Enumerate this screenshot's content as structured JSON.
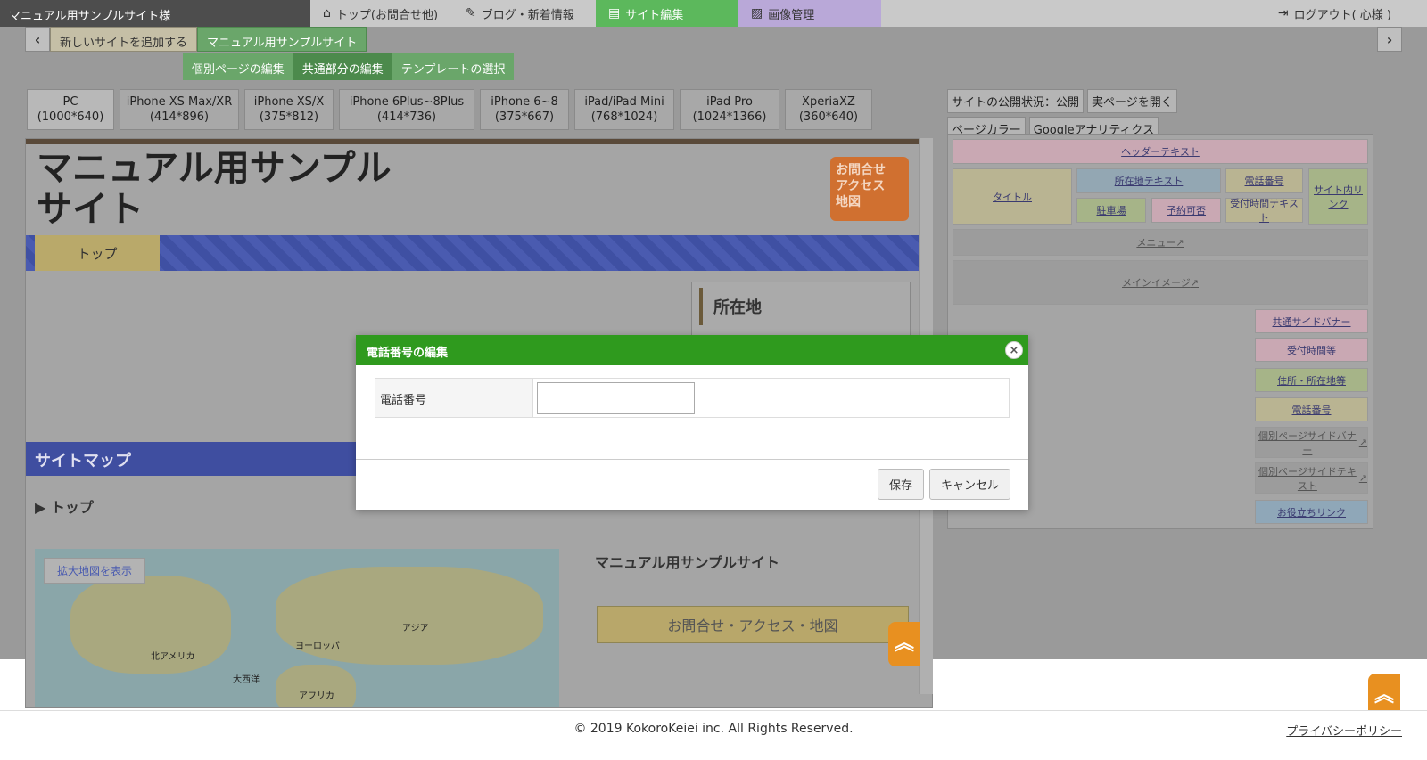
{
  "topnav": {
    "site_name": "マニュアル用サンプルサイト様",
    "tabs": [
      {
        "label": "トップ(お問合せ他)",
        "icon": "home-icon"
      },
      {
        "label": "ブログ・新着情報",
        "icon": "pen-icon"
      },
      {
        "label": "サイト編集",
        "icon": "document-icon"
      },
      {
        "label": "画像管理",
        "icon": "image-icon"
      }
    ],
    "logout": "ログアウト( 心様 )"
  },
  "breadcrumb": {
    "items": [
      "新しいサイトを追加する",
      "マニュアル用サンプルサイト"
    ]
  },
  "subtabs": [
    "個別ページの編集",
    "共通部分の編集",
    "テンプレートの選択"
  ],
  "devices": [
    {
      "name": "PC",
      "size": "(1000*640)"
    },
    {
      "name": "iPhone XS Max/XR",
      "size": "(414*896)"
    },
    {
      "name": "iPhone XS/X",
      "size": "(375*812)"
    },
    {
      "name": "iPhone 6Plus~8Plus",
      "size": "(414*736)"
    },
    {
      "name": "iPhone 6~8",
      "size": "(375*667)"
    },
    {
      "name": "iPad/iPad Mini",
      "size": "(768*1024)"
    },
    {
      "name": "iPad Pro",
      "size": "(1024*1366)"
    },
    {
      "name": "XperiaXZ",
      "size": "(360*640)"
    }
  ],
  "preview": {
    "title_line1": "マニュアル用サンプル",
    "title_line2": "サイト",
    "contact_line1": "お問合せ",
    "contact_line2": "アクセス",
    "contact_line3": "地図",
    "menu_top": "トップ",
    "side_heading": "所在地",
    "sitemap": "サイトマップ",
    "top_link": "トップ",
    "map_button": "拡大地図を表示",
    "map_labels": [
      "北アメリカ",
      "ヨーロッパ",
      "アジア",
      "大西洋",
      "アフリカ"
    ],
    "sitename": "マニュアル用サンプルサイト",
    "cta": "お問合せ・アクセス・地図"
  },
  "right_panel": {
    "buttons": [
      "サイトの公開状況：公開",
      "実ページを開く",
      "ページカラー",
      "Googleアナリティクス"
    ],
    "blocks": {
      "header_text": "ヘッダーテキスト",
      "title": "タイトル",
      "address_text": "所在地テキスト",
      "phone": "電話番号",
      "site_link": "サイト内リンク",
      "parking": "駐車場",
      "reservation": "予約可否",
      "hours_text": "受付時間テキスト",
      "menu": "メニュー",
      "main_image": "メインイメージ",
      "common_banner": "共通サイドバナー",
      "hours": "受付時間等",
      "address": "住所・所在地等",
      "phone2": "電話番号",
      "page_banner": "個別ページサイドバナー",
      "page_text": "個別ページサイドテキスト",
      "useful_link": "お役立ちリンク"
    }
  },
  "modal": {
    "title": "電話番号の編集",
    "field_label": "電話番号",
    "field_value": "",
    "save": "保存",
    "cancel": "キャンセル"
  },
  "footer": {
    "copyright": "© 2019 KokoroKeiei inc. All Rights Reserved.",
    "privacy": "プライバシーポリシー"
  },
  "colors": {
    "modal_header": "#2f9a1e",
    "edit_tab": "#5cb85c",
    "image_tab": "#b9a8d8",
    "menu_bar": "#4a5bb0"
  }
}
